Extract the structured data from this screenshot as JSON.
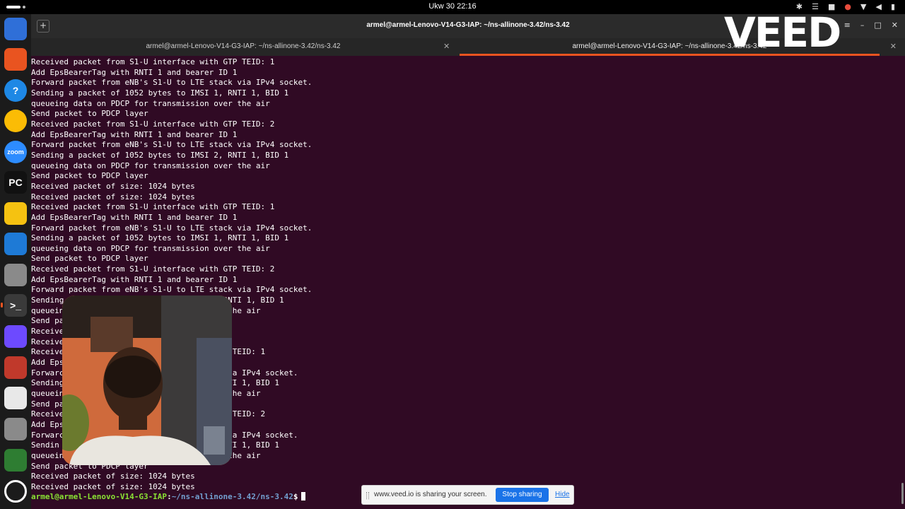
{
  "topbar": {
    "clock": "Ukw 30  22:16",
    "tray_icons": [
      "bluetooth-icon",
      "network-icon",
      "shield-icon",
      "microphone-icon",
      "wifi-icon",
      "volume-icon",
      "battery-icon"
    ]
  },
  "dock": {
    "items": [
      {
        "name": "text-editor",
        "icon": "document-icon",
        "color": "#2f6fd8"
      },
      {
        "name": "app-center",
        "icon": "app-store-icon",
        "color": "#e95420"
      },
      {
        "name": "help",
        "icon": "help-icon",
        "color": "#1e88e5",
        "glyph": "?"
      },
      {
        "name": "chrome",
        "icon": "chrome-icon",
        "color": "#fbbc05"
      },
      {
        "name": "zoom",
        "icon": "zoom-icon",
        "color": "#2d8cff",
        "glyph": "zoom"
      },
      {
        "name": "pycharm",
        "icon": "pycharm-icon",
        "color": "#111111",
        "glyph": "PC"
      },
      {
        "name": "notes",
        "icon": "notepad-icon",
        "color": "#f5c211"
      },
      {
        "name": "vscode",
        "icon": "vscode-icon",
        "color": "#1e7ad6"
      },
      {
        "name": "settings",
        "icon": "gear-icon",
        "color": "#8a8a8a"
      },
      {
        "name": "terminal",
        "icon": "terminal-icon",
        "color": "#3a3a3a",
        "glyph": ">_"
      },
      {
        "name": "proton-vpn",
        "icon": "vpn-icon",
        "color": "#6d4aff"
      },
      {
        "name": "files",
        "icon": "folder-icon",
        "color": "#c0392b"
      },
      {
        "name": "document-viewer",
        "icon": "document-viewer-icon",
        "color": "#e8e8e8"
      },
      {
        "name": "settings-2",
        "icon": "gear-icon",
        "color": "#8a8a8a"
      },
      {
        "name": "trash",
        "icon": "trash-icon",
        "color": "#2e7d32"
      },
      {
        "name": "show-apps",
        "icon": "ubuntu-apps-icon",
        "color": "#1b1b1b"
      }
    ]
  },
  "window": {
    "title": "armel@armel-Lenovo-V14-G3-IAP: ~/ns-allinone-3.42/ns-3.42"
  },
  "tabs": [
    {
      "label": "armel@armel-Lenovo-V14-G3-IAP: ~/ns-allinone-3.42/ns-3.42",
      "active": false
    },
    {
      "label": "armel@armel-Lenovo-V14-G3-IAP: ~/ns-allinone-3.42/ns-3.42",
      "active": true
    }
  ],
  "terminal": {
    "lines": [
      "Received packet from S1-U interface with GTP TEID: 1",
      "Add EpsBearerTag with RNTI 1 and bearer ID 1",
      "Forward packet from eNB's S1-U to LTE stack via IPv4 socket.",
      "Sending a packet of 1052 bytes to IMSI 1, RNTI 1, BID 1",
      "queueing data on PDCP for transmission over the air",
      "Send packet to PDCP layer",
      "Received packet from S1-U interface with GTP TEID: 2",
      "Add EpsBearerTag with RNTI 1 and bearer ID 1",
      "Forward packet from eNB's S1-U to LTE stack via IPv4 socket.",
      "Sending a packet of 1052 bytes to IMSI 2, RNTI 1, BID 1",
      "queueing data on PDCP for transmission over the air",
      "Send packet to PDCP layer",
      "Received packet of size: 1024 bytes",
      "Received packet of size: 1024 bytes",
      "Received packet from S1-U interface with GTP TEID: 1",
      "Add EpsBearerTag with RNTI 1 and bearer ID 1",
      "Forward packet from eNB's S1-U to LTE stack via IPv4 socket.",
      "Sending a packet of 1052 bytes to IMSI 1, RNTI 1, BID 1",
      "queueing data on PDCP for transmission over the air",
      "Send packet to PDCP layer",
      "Received packet from S1-U interface with GTP TEID: 2",
      "Add EpsBearerTag with RNTI 1 and bearer ID 1",
      "Forward packet from eNB's S1-U to LTE stack via IPv4 socket.",
      "Sending                                  RNTI 1, BID 1",
      "queuein                                 r the air",
      "Send pa",
      "Receive",
      "Receive",
      "Receive                                 TP TEID: 1",
      "Add Eps                                 1",
      "Forwarc                                k via IPv4 socket.",
      "Sending                                 RNTI 1, BID 1",
      "queuein                                 r the air",
      "Send pa",
      "Receive                                 TP TEID: 2",
      "Add Eps                                 1",
      "Forwarc                                k via IPv4 socket.",
      "Sendin                                  RNTI 1, BID 1",
      "queuein                                 r the air",
      "Send packet to PDCP layer",
      "Received packet of size: 1024 bytes",
      "Received packet of size: 1024 bytes"
    ],
    "prompt_user": "armel@armel-Lenovo-V14-G3-IAP",
    "prompt_sep": ":",
    "prompt_path": "~/ns-allinone-3.42/ns-3.42",
    "prompt_symbol": "$"
  },
  "overlay": {
    "logo_text": "VEED"
  },
  "share_bar": {
    "message": "www.veed.io is sharing your screen.",
    "stop_label": "Stop sharing",
    "hide_label": "Hide"
  }
}
